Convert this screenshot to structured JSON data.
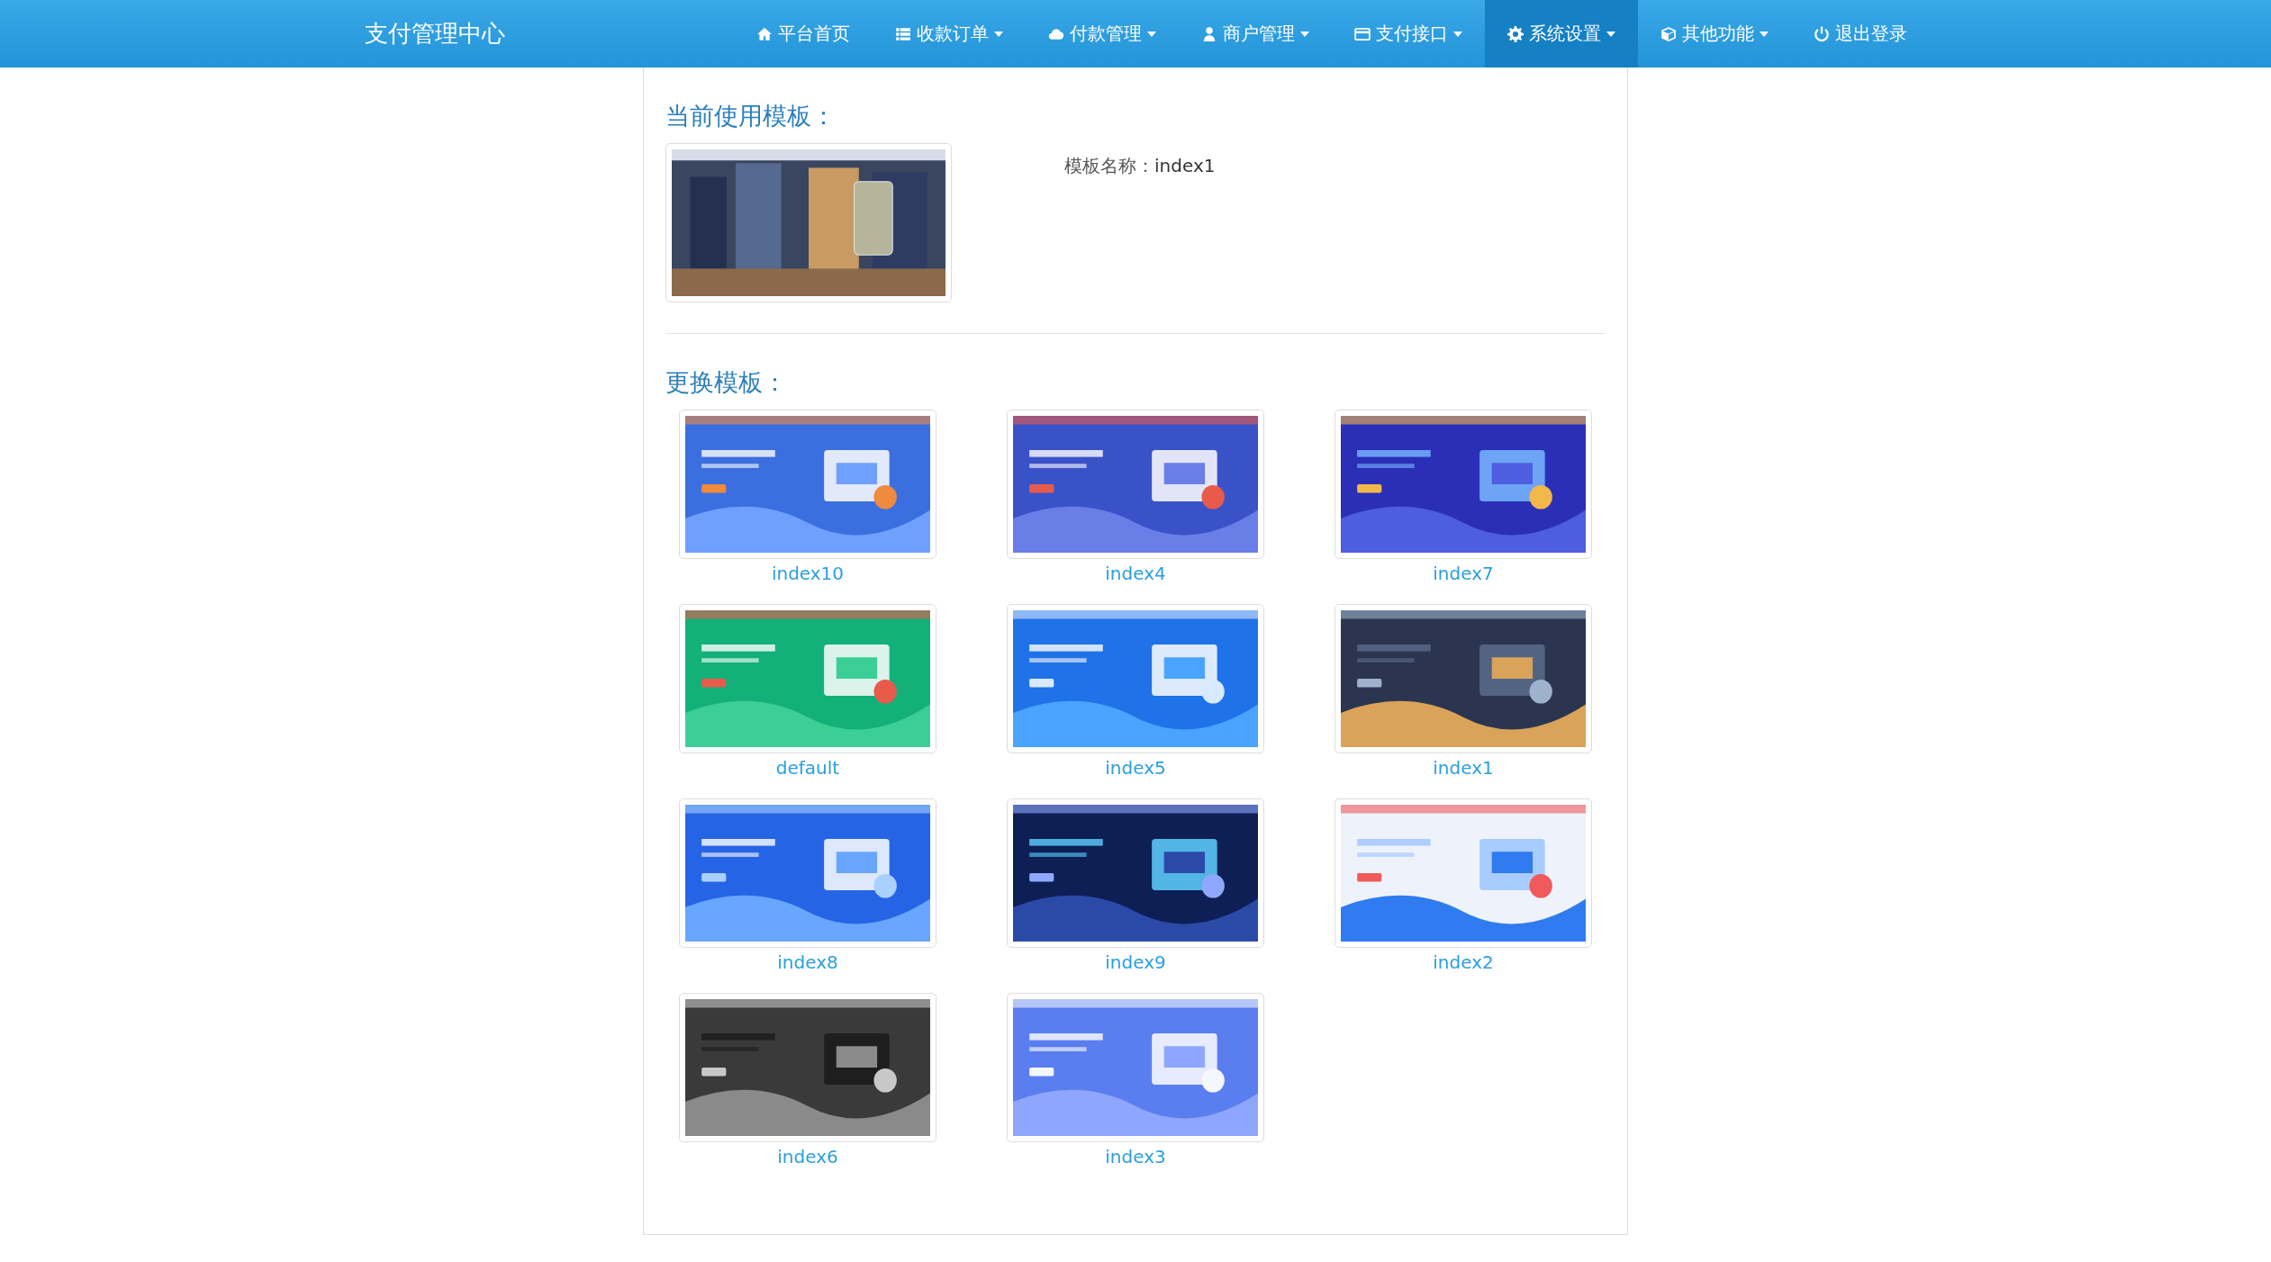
{
  "navbar": {
    "brand": "支付管理中心",
    "items": [
      {
        "kind": "home",
        "label": "平台首页",
        "dropdown": false,
        "selected": false
      },
      {
        "kind": "list",
        "label": "收款订单",
        "dropdown": true,
        "selected": false
      },
      {
        "kind": "cloud",
        "label": "付款管理",
        "dropdown": true,
        "selected": false
      },
      {
        "kind": "user",
        "label": "商户管理",
        "dropdown": true,
        "selected": false
      },
      {
        "kind": "card",
        "label": "支付接口",
        "dropdown": true,
        "selected": false
      },
      {
        "kind": "gear",
        "label": "系统设置",
        "dropdown": true,
        "selected": true
      },
      {
        "kind": "cube",
        "label": "其他功能",
        "dropdown": true,
        "selected": false
      },
      {
        "kind": "power",
        "label": "退出登录",
        "dropdown": false,
        "selected": false
      }
    ]
  },
  "current": {
    "heading": "当前使用模板：",
    "name_label": "模板名称：",
    "name": "index1"
  },
  "change": {
    "heading": "更换模板：",
    "templates": [
      {
        "name": "index10"
      },
      {
        "name": "index4"
      },
      {
        "name": "index7"
      },
      {
        "name": "default"
      },
      {
        "name": "index5"
      },
      {
        "name": "index1"
      },
      {
        "name": "index8"
      },
      {
        "name": "index9"
      },
      {
        "name": "index2"
      },
      {
        "name": "index6"
      },
      {
        "name": "index3"
      }
    ]
  }
}
